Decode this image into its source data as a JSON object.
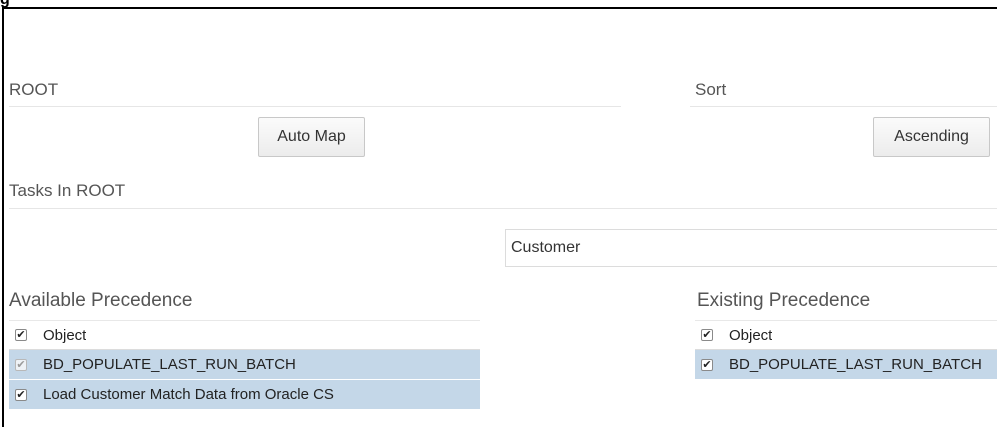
{
  "figure_label": "g",
  "root_section": {
    "title": "ROOT",
    "auto_map_label": "Auto Map"
  },
  "sort_section": {
    "title": "Sort",
    "ascending_label": "Ascending"
  },
  "tasks_section": {
    "title": "Tasks In ROOT",
    "search_value": "Customer"
  },
  "available_precedence": {
    "title": "Available Precedence",
    "header": "Object",
    "rows": [
      {
        "label": "BD_POPULATE_LAST_RUN_BATCH",
        "checked": true,
        "disabled": true
      },
      {
        "label": "Load Customer Match Data from Oracle CS",
        "checked": true,
        "disabled": false
      }
    ]
  },
  "existing_precedence": {
    "title": "Existing Precedence",
    "header": "Object",
    "rows": [
      {
        "label": "BD_POPULATE_LAST_RUN_BATCH",
        "checked": true,
        "disabled": false
      }
    ]
  },
  "colors": {
    "row_selected": "#c4d7e8",
    "title_text": "#555555"
  }
}
